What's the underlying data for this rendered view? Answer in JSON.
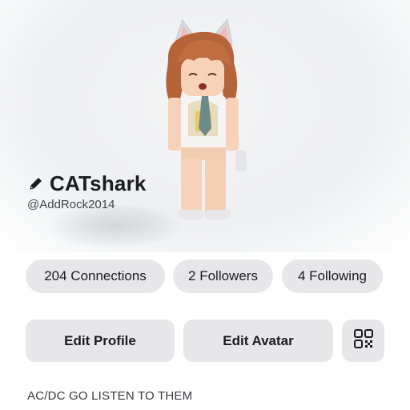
{
  "profile": {
    "display_name": "CATshark",
    "username": "@AddRock2014",
    "bio": "AC/DC GO LISTEN TO THEM"
  },
  "stats": {
    "connections": "204 Connections",
    "followers": "2 Followers",
    "following": "4 Following"
  },
  "actions": {
    "edit_profile": "Edit Profile",
    "edit_avatar": "Edit Avatar",
    "qr_icon": "qr-code-icon"
  },
  "icons": {
    "name_edit": "pencil-icon"
  },
  "colors": {
    "pill_bg": "#e7e7ea",
    "text": "#1c1c1e",
    "hair": "#b5643a",
    "skin": "#f6d2b8"
  }
}
